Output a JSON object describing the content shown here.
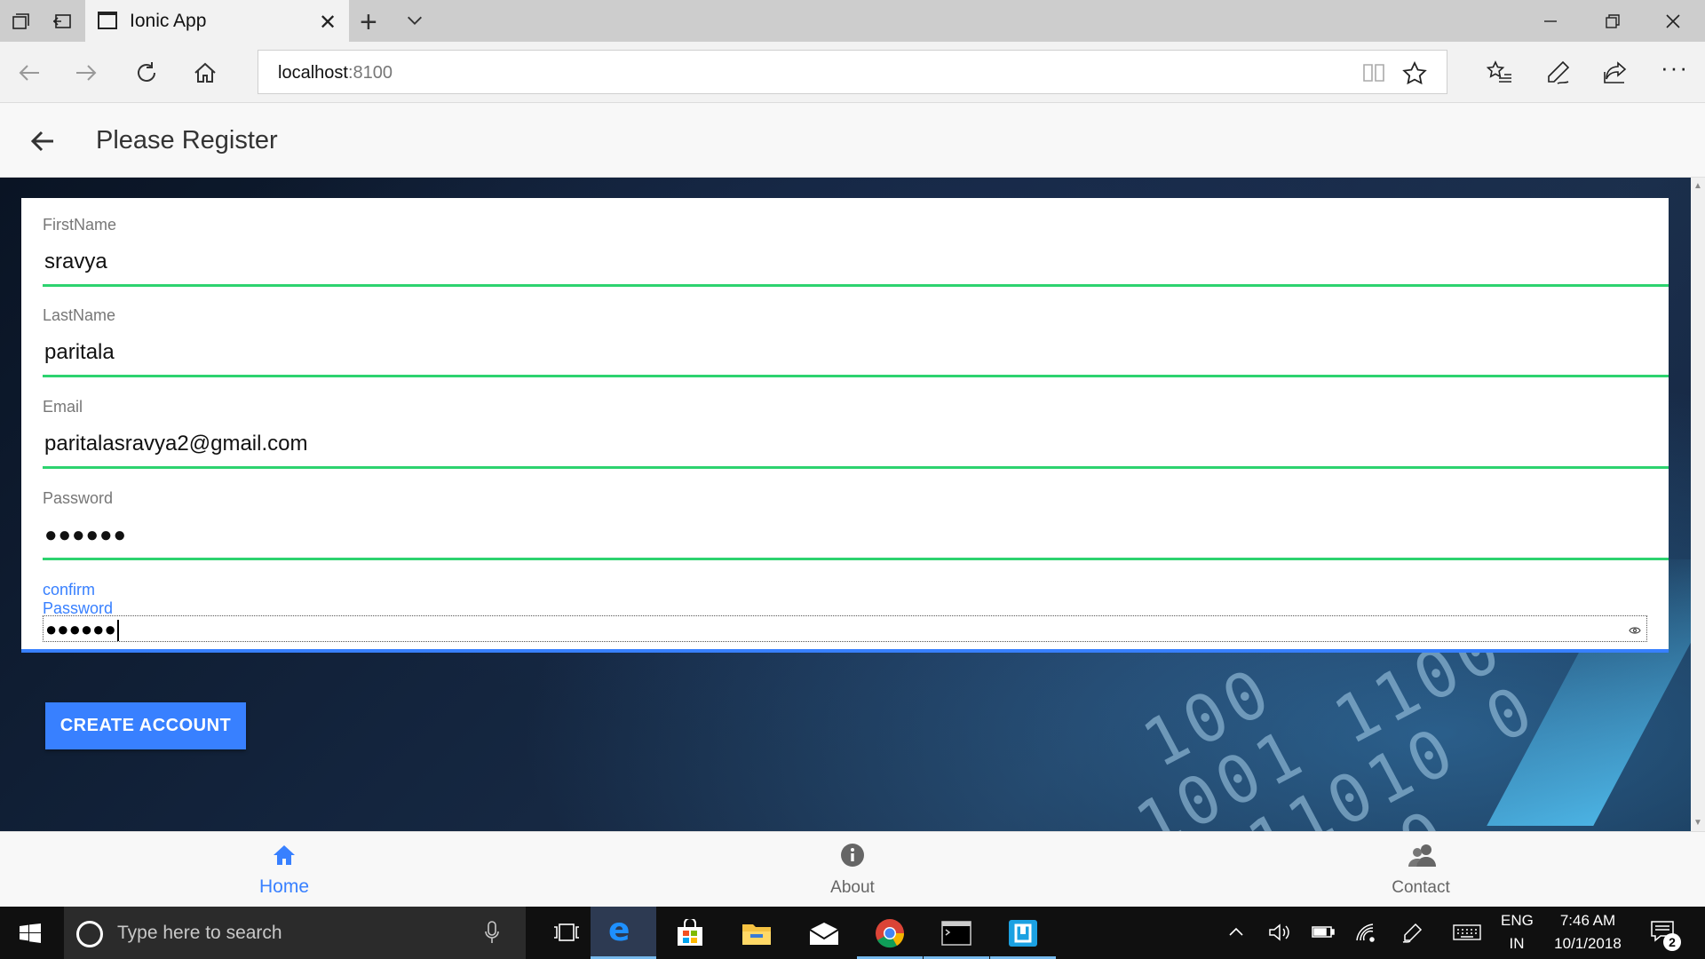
{
  "browser": {
    "tab_title": "Ionic App",
    "url_host": "localhost",
    "url_port": ":8100"
  },
  "header": {
    "title": "Please Register"
  },
  "form": {
    "fields": [
      {
        "label": "FirstName",
        "value": "sravya"
      },
      {
        "label": "LastName",
        "value": "paritala"
      },
      {
        "label": "Email",
        "value": "paritalasravya2@gmail.com"
      },
      {
        "label": "Password",
        "value": "●●●●●●"
      },
      {
        "label": "confirm Password",
        "value": "●●●●●●"
      }
    ],
    "submit_label": "CREATE ACCOUNT"
  },
  "tabbar": {
    "items": [
      {
        "label": "Home",
        "icon": "home-icon",
        "active": true
      },
      {
        "label": "About",
        "icon": "info-icon",
        "active": false
      },
      {
        "label": "Contact",
        "icon": "contacts-icon",
        "active": false
      }
    ]
  },
  "taskbar": {
    "search_placeholder": "Type here to search",
    "language": "ENG",
    "region": "IN",
    "time": "7:46 AM",
    "date": "10/1/2018",
    "notification_count": "2"
  },
  "colors": {
    "primary": "#3880ff",
    "valid_underline": "#2dd36f",
    "header_bg": "#f8f8f8"
  }
}
